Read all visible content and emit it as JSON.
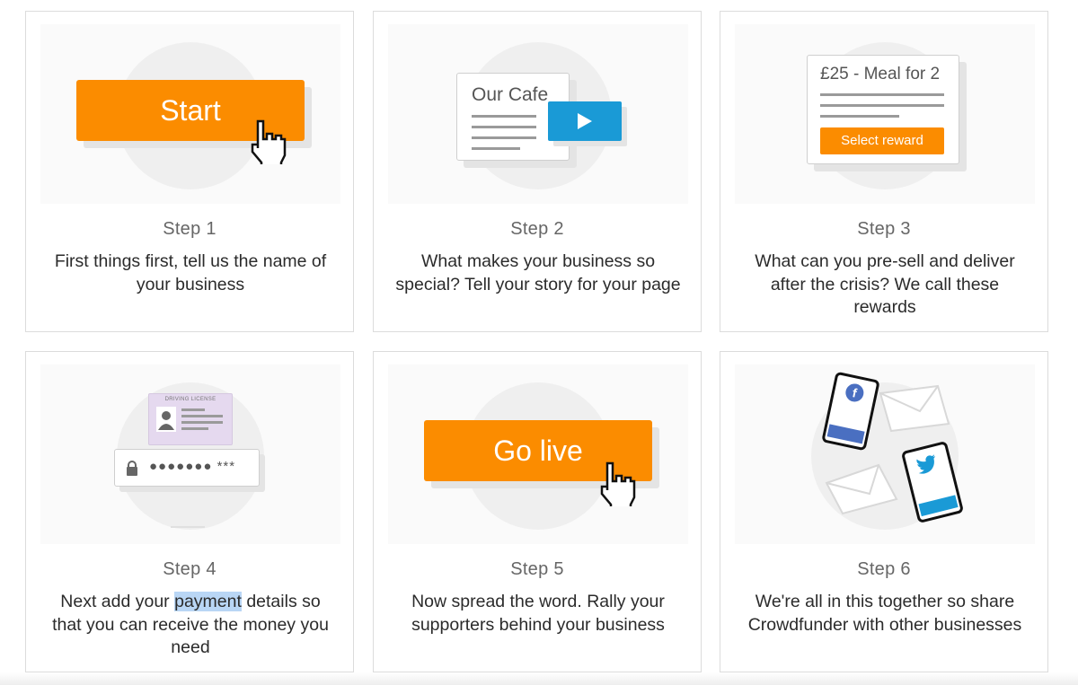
{
  "steps": [
    {
      "label": "Step 1",
      "desc": "First things first, tell us the name of your business",
      "button": "Start"
    },
    {
      "label": "Step 2",
      "desc": "What makes your business so special? Tell your story for your page",
      "card_title": "Our Cafe"
    },
    {
      "label": "Step 3",
      "desc": "What can you pre-sell and deliver after the crisis? We call these rewards",
      "reward_title": "£25 - Meal for 2",
      "reward_button": "Select reward"
    },
    {
      "label": "Step 4",
      "desc_before": "Next add your ",
      "desc_highlight": "payment",
      "desc_after": " details so that you can receive the money you need",
      "license_title": "DRIVING LICENSE",
      "masked": "●●●●●●● ***"
    },
    {
      "label": "Step 5",
      "desc": "Now spread the word. Rally your supporters behind your business",
      "button": "Go live"
    },
    {
      "label": "Step 6",
      "desc": "We're all in this together so share Crowdfunder with other businesses",
      "fb_letter": "f"
    }
  ],
  "colors": {
    "orange": "#fb8c00",
    "blue": "#1a9ad6",
    "facebook": "#4a6fc1"
  }
}
